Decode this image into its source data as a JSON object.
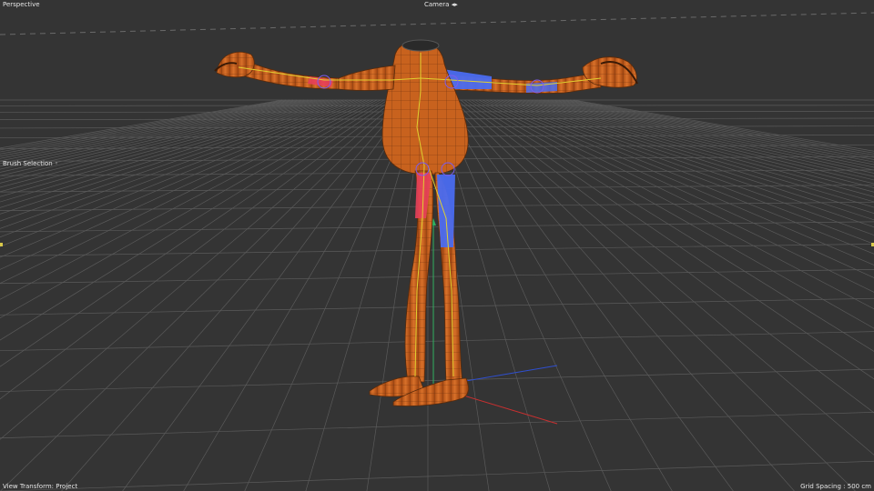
{
  "viewport": {
    "label": "Perspective",
    "camera_menu": "Camera ",
    "camera_icon": "◂▸",
    "brush_selection": "Brush Selection",
    "brush_icon": "◦",
    "view_transform": "View Transform: Project",
    "grid_spacing": "Grid Spacing : 500 cm"
  },
  "colors": {
    "background": "#343434",
    "grid": "#5a5a5a",
    "skin": "#c8621e",
    "wire": "#6e3410",
    "bone_left": "#e8405a",
    "bone_right": "#4a6cf0",
    "skeleton": "#e0d030",
    "axis_x": "#d03030",
    "axis_y": "#30c060",
    "axis_z": "#3050d0"
  },
  "model": {
    "icon": "character-rig-icon"
  }
}
